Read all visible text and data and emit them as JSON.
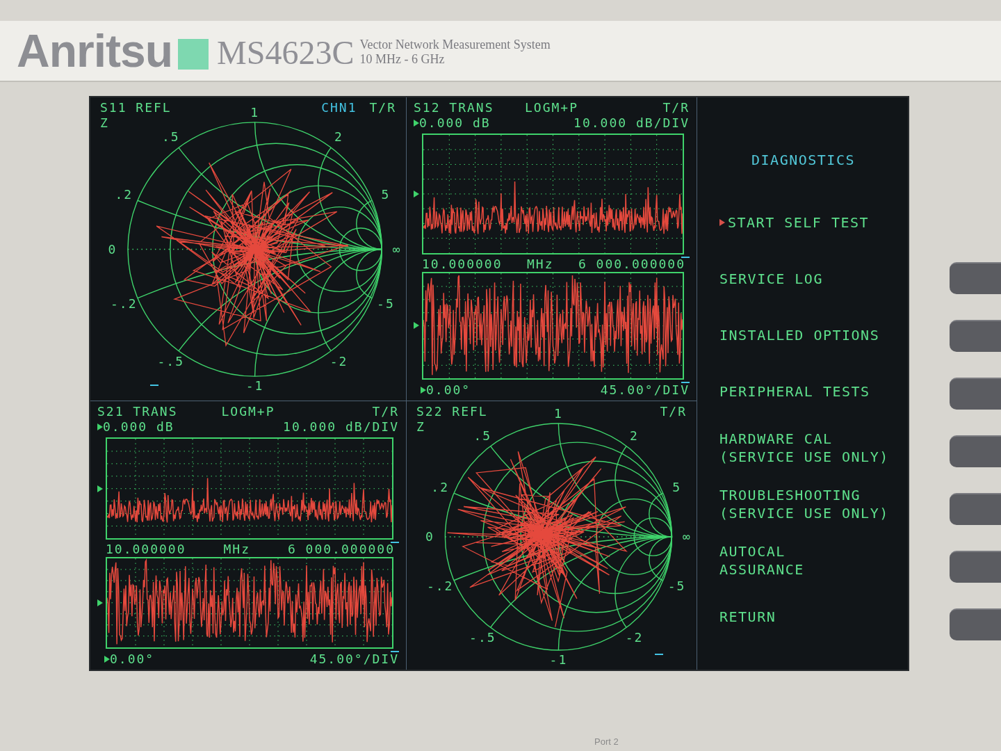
{
  "nameplate": {
    "brand": "Anritsu",
    "model": "MS4623C",
    "description": "Vector Network Measurement System",
    "range": "10 MHz - 6 GHz"
  },
  "panels": [
    {
      "kind": "smith",
      "title": "S11 REFL",
      "format": "Z",
      "channel": "CHN1",
      "mode": "T/R",
      "labels": [
        "1",
        ".5",
        "2",
        ".2",
        "5",
        "0",
        "∞",
        "-.2",
        "-5",
        "-.5",
        "-2",
        "-1"
      ]
    },
    {
      "kind": "rect",
      "title": "S12 TRANS",
      "format": "LOGM+P",
      "mode": "T/R",
      "reference": "0.000 dB",
      "scale": "10.000 dB/DIV",
      "start": "10.000000",
      "unit": "MHz",
      "stop": "6 000.000000",
      "phase_reference": "0.00°",
      "phase_scale": "45.00°/DIV"
    },
    {
      "kind": "rect",
      "title": "S21 TRANS",
      "format": "LOGM+P",
      "mode": "T/R",
      "reference": "0.000 dB",
      "scale": "10.000 dB/DIV",
      "start": "10.000000",
      "unit": "MHz",
      "stop": "6 000.000000",
      "phase_reference": "0.00°",
      "phase_scale": "45.00°/DIV"
    },
    {
      "kind": "smith",
      "title": "S22 REFL",
      "format": "Z",
      "mode": "T/R",
      "labels": [
        "1",
        ".5",
        "2",
        ".2",
        "5",
        "0",
        "∞",
        "-.2",
        "-5",
        "-.5",
        "-2",
        "-1"
      ]
    }
  ],
  "menu": {
    "title": "DIAGNOSTICS",
    "items": [
      {
        "lines": [
          "START SELF TEST"
        ],
        "selected": true
      },
      {
        "lines": [
          "SERVICE LOG"
        ],
        "selected": false
      },
      {
        "lines": [
          "INSTALLED OPTIONS"
        ],
        "selected": false
      },
      {
        "lines": [
          "PERIPHERAL TESTS"
        ],
        "selected": false
      },
      {
        "lines": [
          "HARDWARE CAL",
          "(SERVICE USE ONLY)"
        ],
        "selected": false
      },
      {
        "lines": [
          "TROUBLESHOOTING",
          "(SERVICE USE ONLY)"
        ],
        "selected": false
      },
      {
        "lines": [
          "AUTOCAL",
          "ASSURANCE"
        ],
        "selected": false
      },
      {
        "lines": [
          "RETURN"
        ],
        "selected": false
      }
    ]
  },
  "port_label": "Port 2"
}
